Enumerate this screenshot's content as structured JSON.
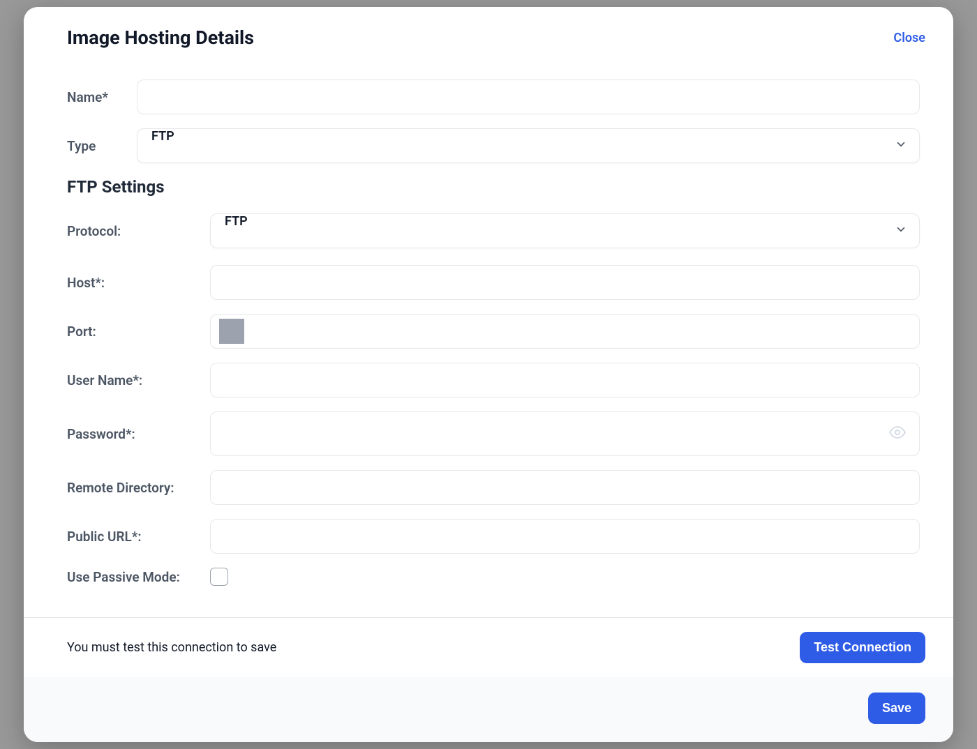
{
  "modal": {
    "title": "Image Hosting Details",
    "close_label": "Close"
  },
  "form": {
    "name_label": "Name*",
    "name_value": "",
    "type_label": "Type",
    "type_value": "FTP"
  },
  "ftp": {
    "section_title": "FTP Settings",
    "protocol_label": "Protocol:",
    "protocol_value": "FTP",
    "host_label": "Host*:",
    "host_value": "",
    "port_label": "Port:",
    "port_value": "",
    "username_label": "User Name*:",
    "username_value": "",
    "password_label": "Password*:",
    "password_value": "",
    "remote_dir_label": "Remote Directory:",
    "remote_dir_value": "",
    "public_url_label": "Public URL*:",
    "public_url_value": "",
    "passive_label": "Use Passive Mode:",
    "passive_checked": false
  },
  "footer": {
    "test_note": "You must test this connection to save",
    "test_button": "Test Connection",
    "save_button": "Save"
  }
}
